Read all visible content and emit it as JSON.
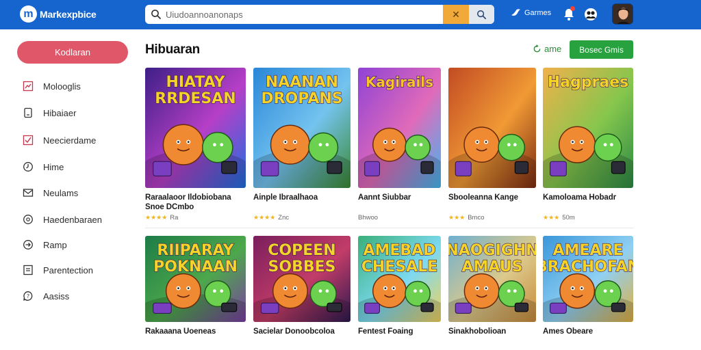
{
  "app": {
    "name": "Markexpbice",
    "logo_letter": "m"
  },
  "search": {
    "placeholder": "Uiudoannoanonaps"
  },
  "topbar": {
    "games_label": "Garmes"
  },
  "sidebar": {
    "cta_label": "Kodlaran",
    "items": [
      {
        "label": "Molooglis",
        "icon": "trend-icon"
      },
      {
        "label": "Hibaiaer",
        "icon": "document-icon"
      },
      {
        "label": "Neecierdame",
        "icon": "check-square-icon"
      },
      {
        "label": "Hime",
        "icon": "clock-icon"
      },
      {
        "label": "Neulams",
        "icon": "mail-icon"
      },
      {
        "label": "Haedenbaraen",
        "icon": "circle-icon"
      },
      {
        "label": "Ramp",
        "icon": "circle-arrow-icon"
      },
      {
        "label": "Parentection",
        "icon": "list-icon"
      },
      {
        "label": "Aasiss",
        "icon": "help-icon"
      }
    ]
  },
  "main": {
    "title": "Hibuaran",
    "game_link_label": "ame",
    "primary_button_label": "Bosec Gmis",
    "cards": [
      {
        "title_line1": "Raraalaoor Ildobiobana",
        "title_line2": "Snoe DCmbo",
        "meta": "Ra",
        "stars": "★★★★",
        "art_title": "HIATAY\nRRDESAN",
        "colors": [
          "#3d1f86",
          "#b63fc7",
          "#1f6fe0"
        ],
        "accent": "#f6d329"
      },
      {
        "title_line1": "Ainple Ibraalhaoa",
        "title_line2": "",
        "meta": "Znc",
        "stars": "★★★★",
        "art_title": "NAANAN\nDROPANS",
        "colors": [
          "#2a87d8",
          "#74c3ef",
          "#3b8a34"
        ],
        "accent": "#f6d329"
      },
      {
        "title_line1": "Aannt Siubbar",
        "title_line2": "",
        "meta": "Bhwoo",
        "stars": "",
        "art_title": "Kagirails",
        "colors": [
          "#8f43d6",
          "#e06ab9",
          "#44b8f0"
        ],
        "accent": "#f8c430"
      },
      {
        "title_line1": "Sbooleanna Kange",
        "title_line2": "",
        "meta": "Bmco",
        "stars": "★★★",
        "art_title": "",
        "colors": [
          "#c24b23",
          "#f09a35",
          "#7c2b12"
        ],
        "accent": "#f5c04a"
      },
      {
        "title_line1": "Kamoloama Hobadr",
        "title_line2": "",
        "meta": "50m",
        "stars": "★★★",
        "art_title": "Hagpraes",
        "colors": [
          "#f0b14b",
          "#85c64d",
          "#2c8a45"
        ],
        "accent": "#f6d329"
      },
      {
        "title_line1": "Rakaaana Uoeneas",
        "title_line2": "",
        "meta": "",
        "stars": "",
        "art_title": "RIIPARAY\nPOKNAAN",
        "colors": [
          "#1d7c47",
          "#4da84b",
          "#7b3fa3"
        ],
        "accent": "#f6d329"
      },
      {
        "title_line1": "Sacielar Donoobcoloa",
        "title_line2": "",
        "meta": "",
        "stars": "",
        "art_title": "COPEEN\nSOBBES",
        "colors": [
          "#7a1f5d",
          "#c23c68",
          "#2d1a4f"
        ],
        "accent": "#f6d329"
      },
      {
        "title_line1": "Fentest Foaing",
        "title_line2": "",
        "meta": "",
        "stars": "",
        "art_title": "AMEBAD\nCHESALE",
        "colors": [
          "#39b07a",
          "#7dd9f0",
          "#f1d25d"
        ],
        "accent": "#f6d329"
      },
      {
        "title_line1": "Sinakhobolioan",
        "title_line2": "",
        "meta": "",
        "stars": "",
        "art_title": "NAOGIGHN\nAMAUS",
        "colors": [
          "#6eb0d0",
          "#dcc98b",
          "#c88b3b"
        ],
        "accent": "#f6d329"
      },
      {
        "title_line1": "Ames Obeare",
        "title_line2": "",
        "meta": "",
        "stars": "",
        "art_title": "AMEARE\nBRACHOFAN",
        "colors": [
          "#3a96d9",
          "#8fd0f3",
          "#e0b040"
        ],
        "accent": "#f6d329"
      }
    ]
  }
}
